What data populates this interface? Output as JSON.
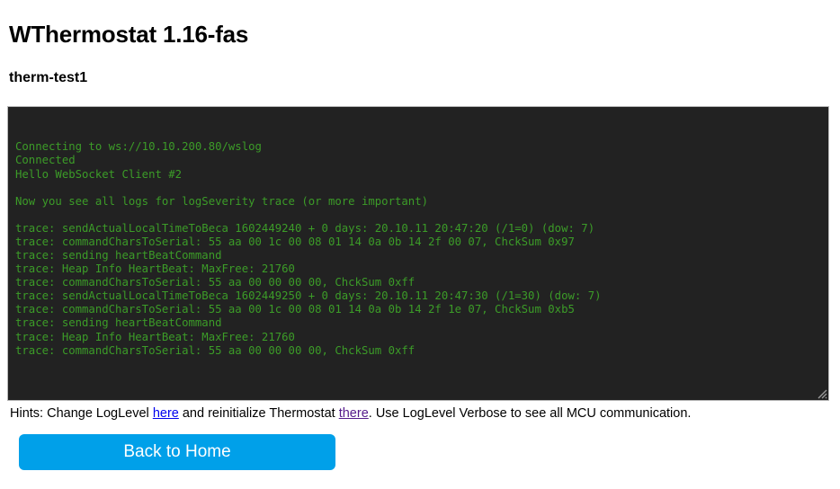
{
  "header": {
    "app_title": "WThermostat 1.16-fas",
    "device_name": "therm-test1"
  },
  "console": {
    "lines": [
      "Connecting to ws://10.10.200.80/wslog",
      "Connected",
      "Hello WebSocket Client #2",
      "",
      "Now you see all logs for logSeverity trace (or more important)",
      "",
      "trace: sendActualLocalTimeToBeca 1602449240 + 0 days: 20.10.11 20:47:20 (/1=0) (dow: 7)",
      "trace: commandCharsToSerial: 55 aa 00 1c 00 08 01 14 0a 0b 14 2f 00 07, ChckSum 0x97",
      "trace: sending heartBeatCommand",
      "trace: Heap Info HeartBeat: MaxFree: 21760",
      "trace: commandCharsToSerial: 55 aa 00 00 00 00, ChckSum 0xff",
      "trace: sendActualLocalTimeToBeca 1602449250 + 0 days: 20.10.11 20:47:30 (/1=30) (dow: 7)",
      "trace: commandCharsToSerial: 55 aa 00 1c 00 08 01 14 0a 0b 14 2f 1e 07, ChckSum 0xb5",
      "trace: sending heartBeatCommand",
      "trace: Heap Info HeartBeat: MaxFree: 21760",
      "trace: commandCharsToSerial: 55 aa 00 00 00 00, ChckSum 0xff"
    ],
    "text_color": "#3c9c28",
    "background_color": "#222222"
  },
  "hints": {
    "prefix": "Hints: Change LogLevel ",
    "link_here": "here",
    "middle": " and reinitialize Thermostat ",
    "link_there": "there",
    "suffix": ". Use LogLevel Verbose to see all MCU communication."
  },
  "actions": {
    "back_to_home": "Back to Home",
    "button_color": "#00a0e9"
  }
}
